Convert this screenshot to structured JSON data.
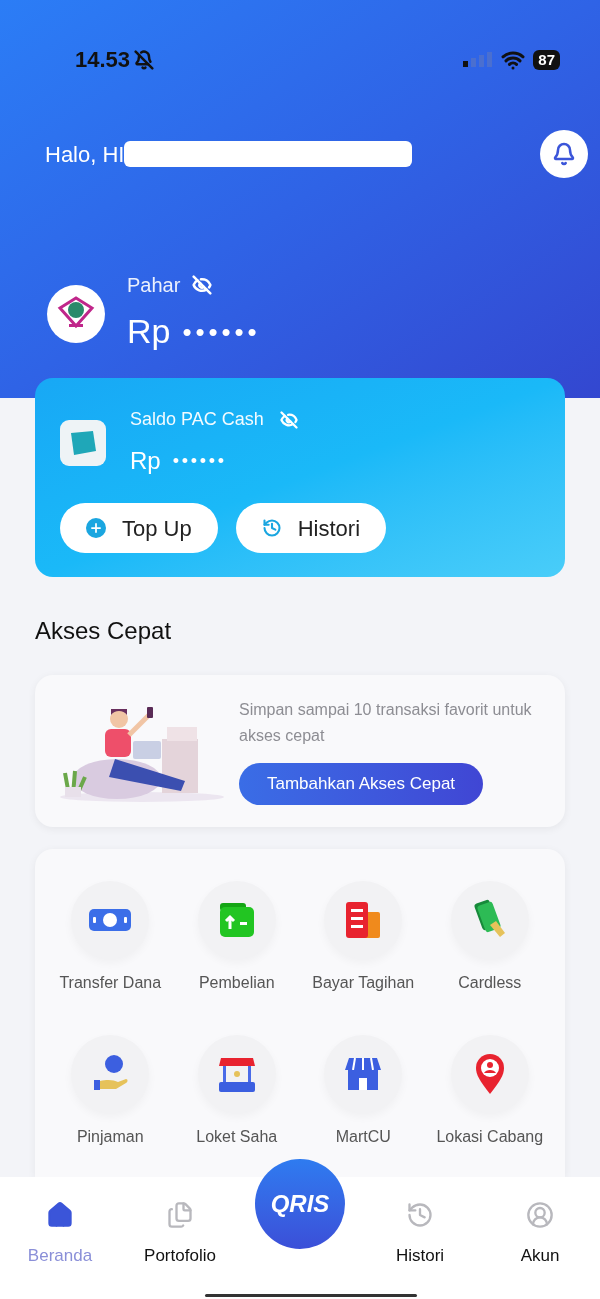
{
  "status_bar": {
    "time": "14.53",
    "battery": "87"
  },
  "greeting": {
    "text": "Halo, HI"
  },
  "account": {
    "name": "Pahar",
    "currency": "Rp",
    "amount": "••••••"
  },
  "wallet": {
    "label": "Saldo PAC Cash",
    "currency": "Rp",
    "amount": "••••••",
    "buttons": [
      {
        "label": "Top Up",
        "kind": "add"
      },
      {
        "label": "Histori",
        "kind": "history"
      }
    ]
  },
  "quick_access": {
    "title": "Akses Cepat",
    "message": "Simpan sampai 10 transaksi favorit untuk akses cepat",
    "button": "Tambahkan Akses Cepat"
  },
  "menu": [
    {
      "label": "Transfer Dana",
      "kind": "transfer"
    },
    {
      "label": "Pembelian",
      "kind": "purchase"
    },
    {
      "label": "Bayar Tagihan",
      "kind": "bill"
    },
    {
      "label": "Cardless",
      "kind": "cash"
    },
    {
      "label": "Pinjaman",
      "kind": "loan"
    },
    {
      "label": "Loket Saha",
      "kind": "counter"
    },
    {
      "label": "MartCU",
      "kind": "store"
    },
    {
      "label": "Lokasi Cabang",
      "kind": "location"
    }
  ],
  "bottom_nav": [
    {
      "label": "Beranda",
      "kind": "home",
      "selected": true
    },
    {
      "label": "Portofolio",
      "kind": "files",
      "selected": false
    },
    {
      "label": "QRIS",
      "kind": "qris",
      "selected": false
    },
    {
      "label": "Histori",
      "kind": "history",
      "selected": false
    },
    {
      "label": "Akun",
      "kind": "account",
      "selected": false
    }
  ]
}
